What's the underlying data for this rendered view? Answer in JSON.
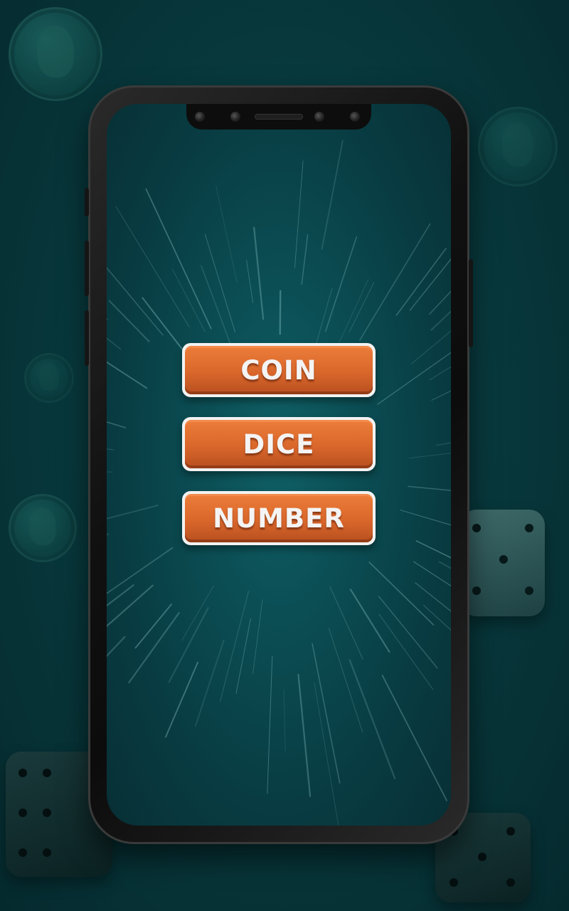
{
  "menu": {
    "items": [
      {
        "label": "COIN"
      },
      {
        "label": "DICE"
      },
      {
        "label": "NUMBER"
      }
    ]
  },
  "icons": {
    "background_coin": "quarter-coin-icon",
    "background_die": "die-icon"
  },
  "colors": {
    "background": "#083a3e",
    "screen": "#0b4f55",
    "button_fill": "#d9672b",
    "button_border": "#f2f2f2",
    "button_text": "#f4f4f4"
  }
}
